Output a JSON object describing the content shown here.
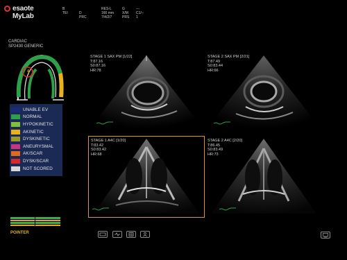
{
  "logo": {
    "brand": "esaote MyLab"
  },
  "header": {
    "col1": [
      "B",
      "TEI"
    ],
    "col2": [
      "",
      "D",
      "PRC"
    ],
    "col3": [
      "RES-L",
      "160 mm",
      "7/4/2/7"
    ],
    "col4": [
      "G",
      "X/M",
      "PRS"
    ],
    "col5": [
      "---",
      "C1/--",
      "1"
    ]
  },
  "exam": {
    "type": "CARDIAC",
    "probe": "SP2430  GENERIC"
  },
  "legend": [
    {
      "label": "UNABLE EV",
      "color": "#1c2a7a"
    },
    {
      "label": "NORMAL",
      "color": "#2fa04a"
    },
    {
      "label": "HYPOKINETIC",
      "color": "#7fbf3a"
    },
    {
      "label": "AKINETIC",
      "color": "#e8b21c"
    },
    {
      "label": "DYSKINETIC",
      "color": "#9a9a2a"
    },
    {
      "label": "ANEURYSMAL",
      "color": "#c2377e"
    },
    {
      "label": "AK/SCAR",
      "color": "#e06a1e"
    },
    {
      "label": "DYSK/SCAR",
      "color": "#d7282a"
    },
    {
      "label": "NOT SCORED",
      "color": "#d8d8d8"
    }
  ],
  "pointer": "POINTER",
  "views": [
    {
      "title": "STAGE 1 SAX PM [1/22]",
      "line2": "T:87.16",
      "line3": "S0:87.16",
      "line4": "HR:78"
    },
    {
      "title": "STAGE 2 SAX PM [2/21]",
      "line2": "T:87.49",
      "line3": "S0:83.44",
      "line4": "HR:66"
    },
    {
      "title": "STAGE 1 A4C [1/20]",
      "line2": "T:83.42",
      "line3": "S0:83.42",
      "line4": "HR:68"
    },
    {
      "title": "STAGE 2 A4C [2/20]",
      "line2": "T:86.45",
      "line3": "S0:83.49",
      "line4": "HR:73"
    }
  ],
  "toolbar": [
    "film-icon",
    "loop-icon",
    "grid-icon",
    "person-icon"
  ],
  "corner_icon": "monitor-icon"
}
